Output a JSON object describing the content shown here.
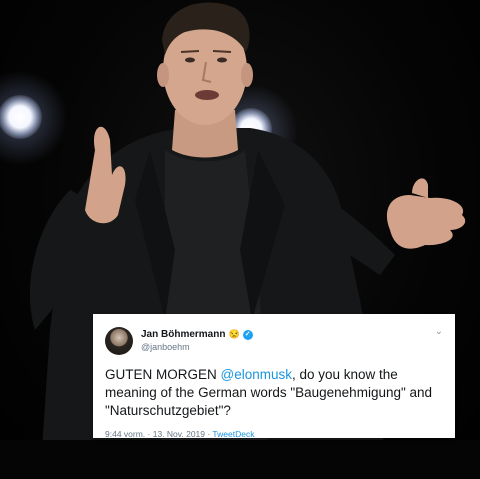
{
  "tweet": {
    "display_name": "Jan Böhmermann",
    "emoji": "😒",
    "verified_mark": "✓",
    "handle": "@janboehm",
    "text_before": "GUTEN MORGEN ",
    "mention": "@elonmusk",
    "text_after": ", do you know the meaning of the German words \"Baugenehmigung\" and \"Naturschutzgebiet\"?",
    "time": "9:44 vorm.",
    "separator1": " · ",
    "date": "13. Nov. 2019",
    "separator2": " · ",
    "source": "TweetDeck",
    "chevron_icon": "chevron-down-icon"
  },
  "colors": {
    "link": "#1b95e0",
    "verified": "#1da1f2",
    "text": "#14171a",
    "muted": "#657786"
  }
}
